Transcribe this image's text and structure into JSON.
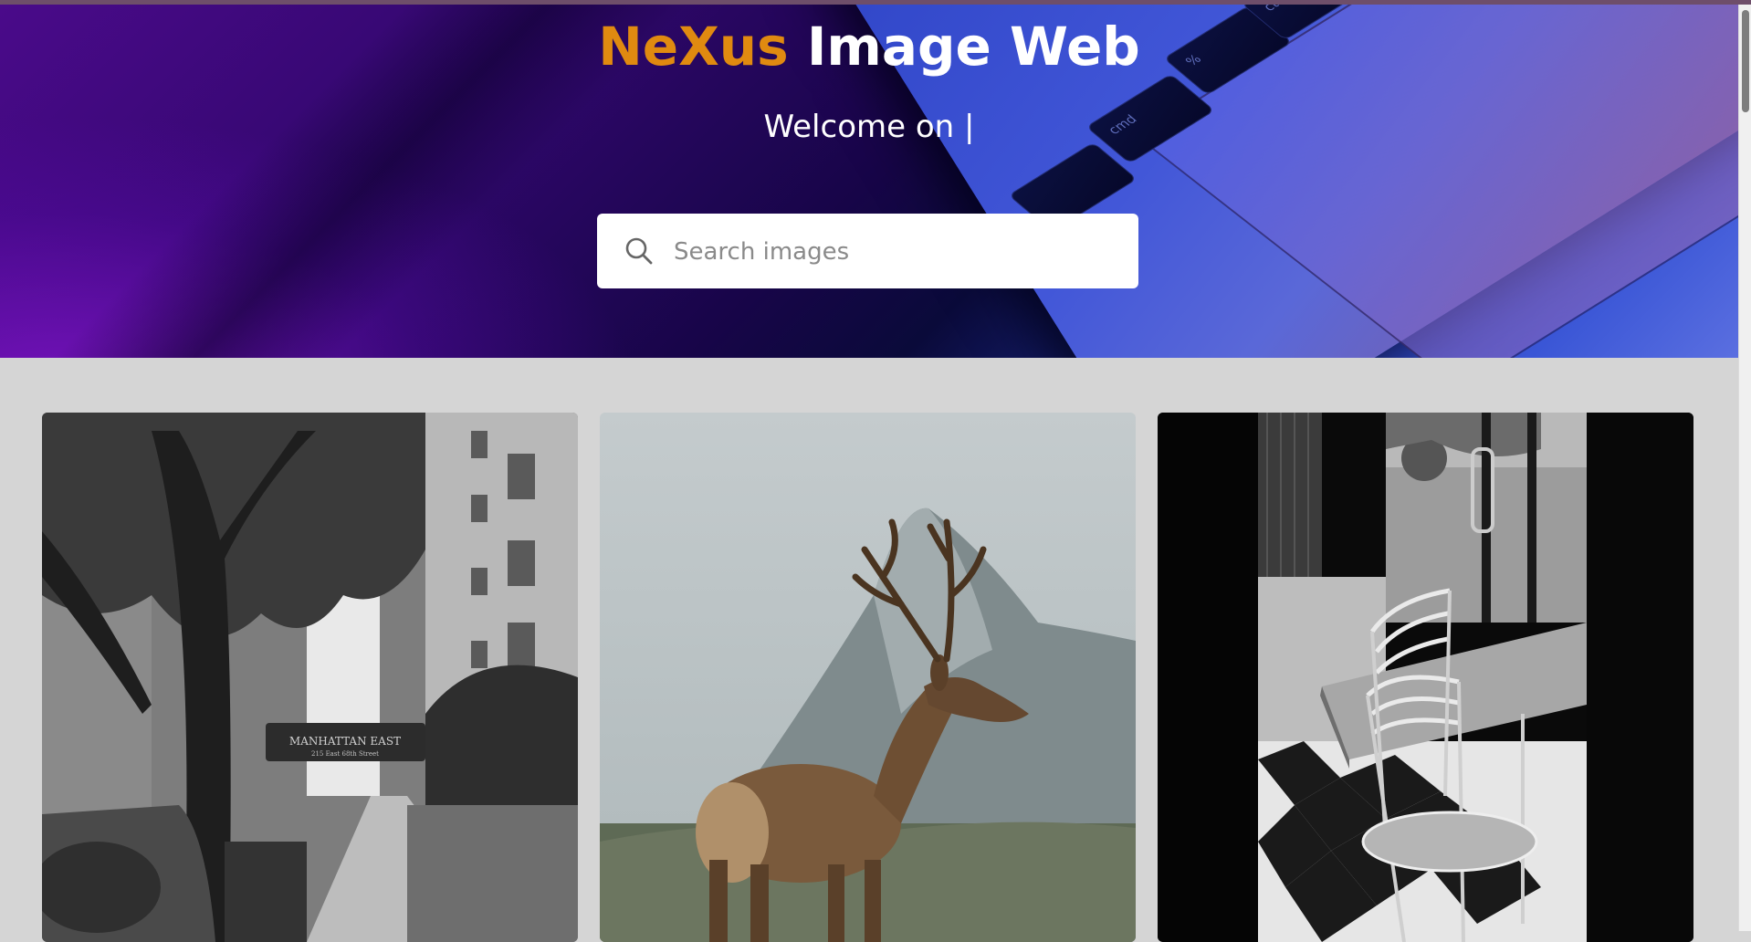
{
  "header": {
    "brand": "NeXus",
    "title_rest": "Image Web",
    "welcome": "Welcome on |"
  },
  "search": {
    "placeholder": "Search images",
    "value": ""
  },
  "keys": [
    "cmd",
    "%",
    "ctrl"
  ],
  "gallery": {
    "images": [
      {
        "name": "street-photo",
        "sign_text": "MANHATTAN EAST",
        "sign_subtext": "215 East 68th Street"
      },
      {
        "name": "deer-photo"
      },
      {
        "name": "cafe-chairs-photo"
      }
    ]
  },
  "colors": {
    "brand_orange": "#e08a10",
    "page_bg": "#d5d5d5",
    "hero_purple": "#4a0a8a",
    "hero_blue": "#3a56d6"
  }
}
